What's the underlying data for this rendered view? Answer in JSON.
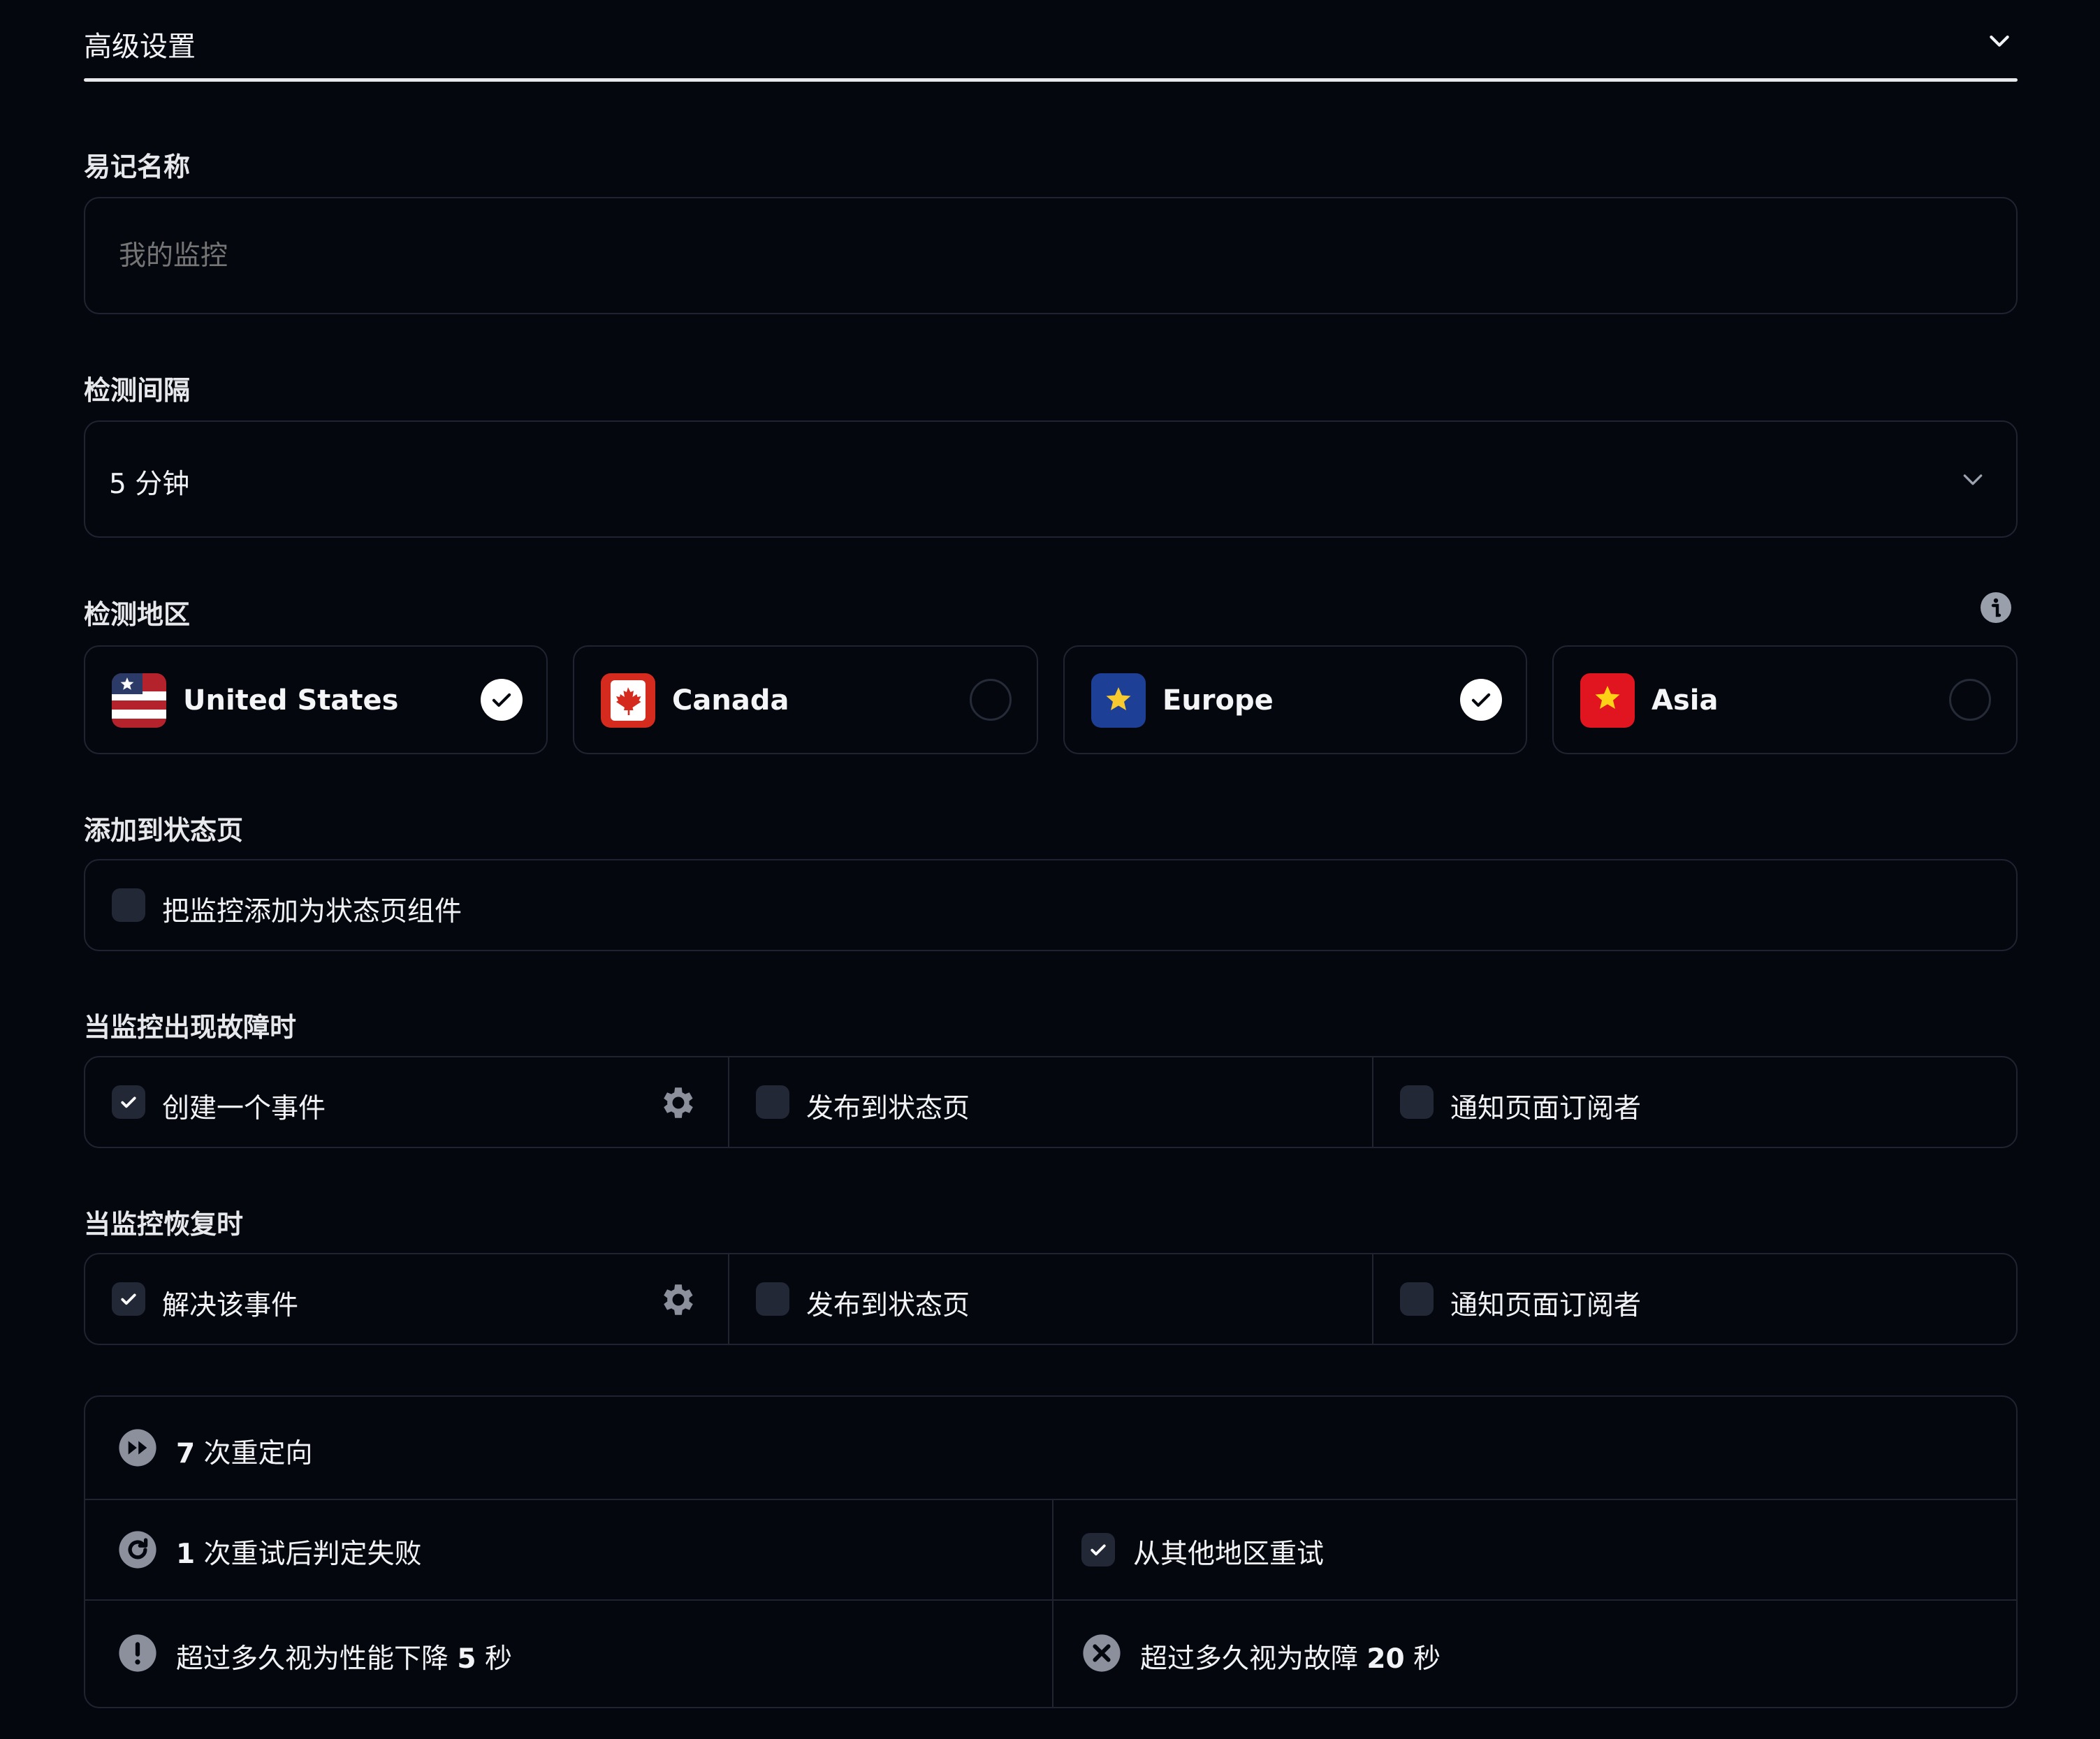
{
  "section": {
    "title": "高级设置"
  },
  "friendly_name": {
    "label": "易记名称",
    "placeholder": "我的监控",
    "value": ""
  },
  "interval": {
    "label": "检测间隔",
    "value": "5 分钟"
  },
  "regions": {
    "label": "检测地区",
    "items": [
      {
        "name": "United States",
        "selected": true
      },
      {
        "name": "Canada",
        "selected": false
      },
      {
        "name": "Europe",
        "selected": true
      },
      {
        "name": "Asia",
        "selected": false
      }
    ]
  },
  "status_page": {
    "label": "添加到状态页",
    "option": "把监控添加为状态页组件",
    "checked": false
  },
  "on_down": {
    "label": "当监控出现故障时",
    "options": [
      {
        "text": "创建一个事件",
        "checked": true
      },
      {
        "text": "发布到状态页",
        "checked": false
      },
      {
        "text": "通知页面订阅者",
        "checked": false
      }
    ]
  },
  "on_up": {
    "label": "当监控恢复时",
    "options": [
      {
        "text": "解决该事件",
        "checked": true
      },
      {
        "text": "发布到状态页",
        "checked": false
      },
      {
        "text": "通知页面订阅者",
        "checked": false
      }
    ]
  },
  "summary": {
    "redirects": {
      "count": "7",
      "text": "次重定向"
    },
    "retries": {
      "count": "1",
      "text": "次重试后判定失败"
    },
    "retry_other_regions": {
      "text": "从其他地区重试",
      "checked": true
    },
    "degraded": {
      "text": "超过多久视为性能下降",
      "value": "5",
      "unit": "秒"
    },
    "down": {
      "text": "超过多久视为故障",
      "value": "20",
      "unit": "秒"
    }
  },
  "icons": {
    "collapse": "chevron-down-icon",
    "select": "chevron-down-icon",
    "info": "info-icon",
    "settings": "gear-icon",
    "redirect": "fast-forward-icon",
    "retry": "refresh-icon",
    "degraded": "exclamation-icon",
    "down": "x-circle-icon"
  },
  "colors": {
    "background": "#05070f",
    "border": "#1f2430",
    "text": "#f1f3f6",
    "muted": "#6b7280"
  }
}
